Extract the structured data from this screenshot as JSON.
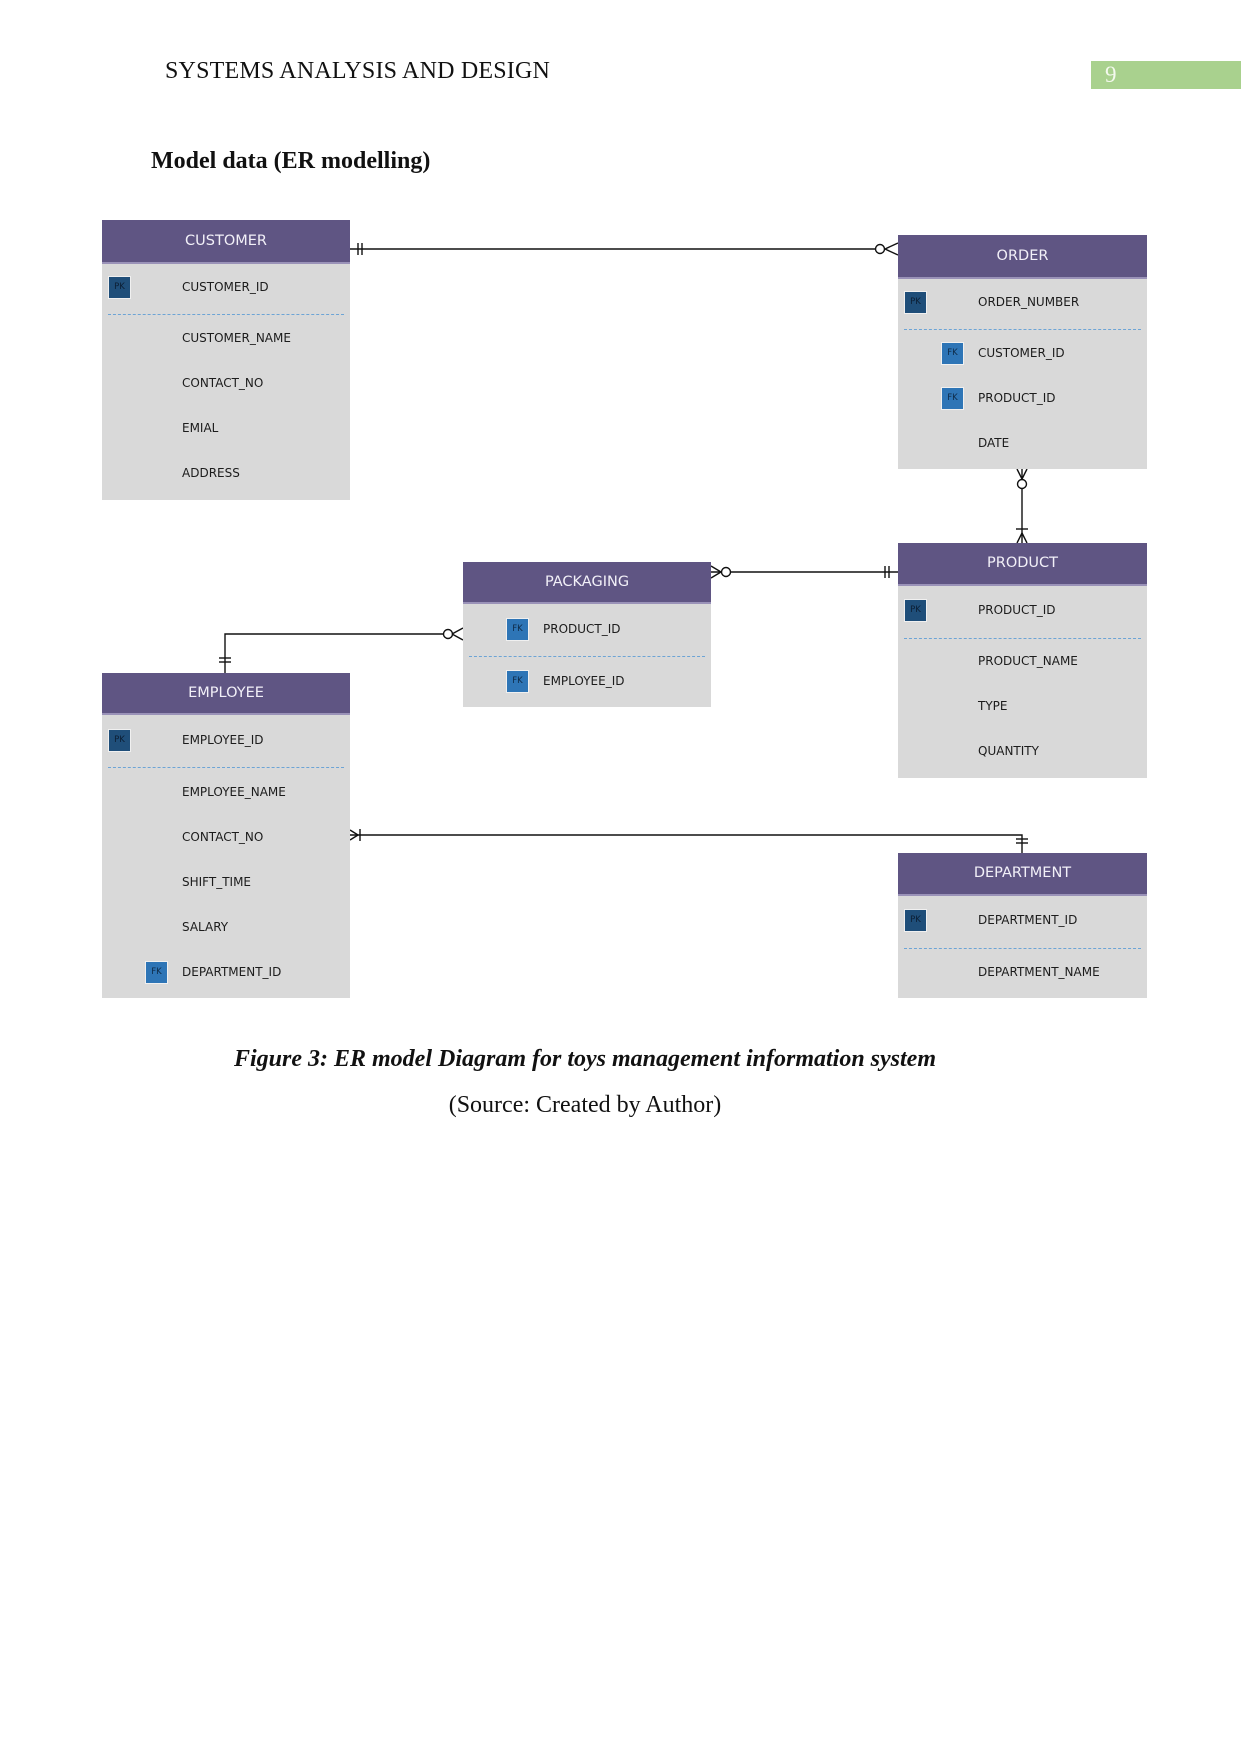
{
  "header": {
    "running_title": "SYSTEMS ANALYSIS AND DESIGN",
    "page_number": "9",
    "page_badge_color": "#a9d18e"
  },
  "section": {
    "title": "Model data (ER modelling)"
  },
  "colors": {
    "entity_header": "#5f5583",
    "entity_body": "#d9d9d9",
    "pk_badge": "#1f4e79",
    "fk_badge": "#2e75b6"
  },
  "key_labels": {
    "pk": "PK",
    "fk": "FK"
  },
  "entities": {
    "customer": {
      "name": "CUSTOMER",
      "attributes": [
        {
          "name": "CUSTOMER_ID",
          "key": "PK"
        },
        {
          "name": "CUSTOMER_NAME",
          "key": ""
        },
        {
          "name": "CONTACT_NO",
          "key": ""
        },
        {
          "name": "EMIAL",
          "key": ""
        },
        {
          "name": "ADDRESS",
          "key": ""
        }
      ]
    },
    "order": {
      "name": "ORDER",
      "attributes": [
        {
          "name": "ORDER_NUMBER",
          "key": "PK"
        },
        {
          "name": "CUSTOMER_ID",
          "key": "FK"
        },
        {
          "name": "PRODUCT_ID",
          "key": "FK"
        },
        {
          "name": "DATE",
          "key": ""
        }
      ]
    },
    "packaging": {
      "name": "PACKAGING",
      "attributes": [
        {
          "name": "PRODUCT_ID",
          "key": "FK"
        },
        {
          "name": "EMPLOYEE_ID",
          "key": "FK"
        }
      ]
    },
    "product": {
      "name": "PRODUCT",
      "attributes": [
        {
          "name": "PRODUCT_ID",
          "key": "PK"
        },
        {
          "name": "PRODUCT_NAME",
          "key": ""
        },
        {
          "name": "TYPE",
          "key": ""
        },
        {
          "name": "QUANTITY",
          "key": ""
        }
      ]
    },
    "employee": {
      "name": "EMPLOYEE",
      "attributes": [
        {
          "name": "EMPLOYEE_ID",
          "key": "PK"
        },
        {
          "name": "EMPLOYEE_NAME",
          "key": ""
        },
        {
          "name": "CONTACT_NO",
          "key": ""
        },
        {
          "name": "SHIFT_TIME",
          "key": ""
        },
        {
          "name": "SALARY",
          "key": ""
        },
        {
          "name": "DEPARTMENT_ID",
          "key": "FK"
        }
      ]
    },
    "department": {
      "name": "DEPARTMENT",
      "attributes": [
        {
          "name": "DEPARTMENT_ID",
          "key": "PK"
        },
        {
          "name": "DEPARTMENT_NAME",
          "key": ""
        }
      ]
    }
  },
  "relationships": [
    {
      "from": "CUSTOMER",
      "from_cardinality": "one-and-only-one",
      "to": "ORDER",
      "to_cardinality": "zero-or-many"
    },
    {
      "from": "PRODUCT",
      "from_cardinality": "one-or-many",
      "to": "ORDER",
      "to_cardinality": "zero-or-many"
    },
    {
      "from": "PRODUCT",
      "from_cardinality": "one-and-only-one",
      "to": "PACKAGING",
      "to_cardinality": "zero-or-many"
    },
    {
      "from": "EMPLOYEE",
      "from_cardinality": "one-and-only-one",
      "to": "PACKAGING",
      "to_cardinality": "zero-or-many"
    },
    {
      "from": "DEPARTMENT",
      "from_cardinality": "one-and-only-one",
      "to": "EMPLOYEE",
      "to_cardinality": "one-or-many"
    }
  ],
  "caption": {
    "figure": "Figure 3: ER model Diagram for toys management information system",
    "source": "(Source: Created by Author)"
  }
}
